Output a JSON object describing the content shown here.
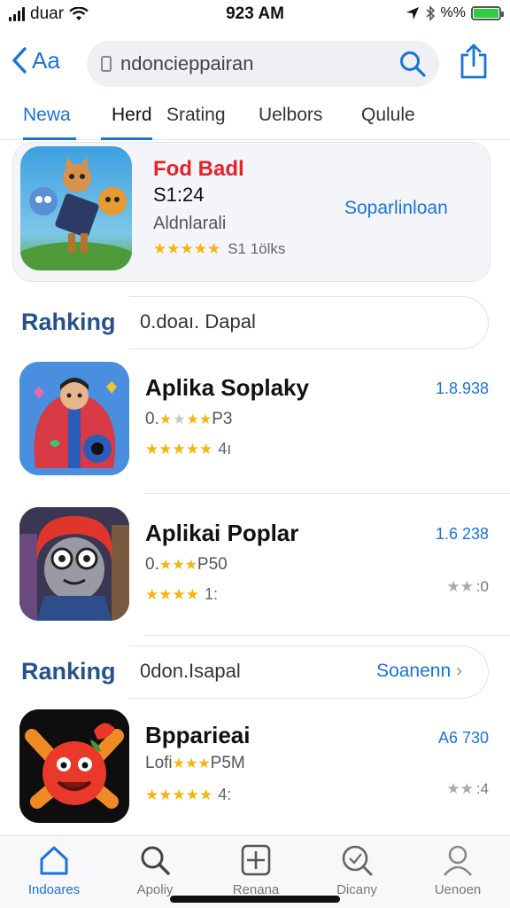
{
  "status_bar": {
    "carrier": "duar",
    "time": "923 AM",
    "battery_text": "%%"
  },
  "nav": {
    "back_label": "Aa",
    "search_value": "ndoncieppairan",
    "search_placeholder": ""
  },
  "tabs": [
    {
      "label": "Newa",
      "active": true
    },
    {
      "label": "Herd",
      "active": false
    },
    {
      "label": "Srating",
      "active": false
    },
    {
      "label": "Uelbors",
      "active": false
    },
    {
      "label": "Qulule",
      "active": false
    }
  ],
  "featured": {
    "title": "Fod Badl",
    "price": "S1:24",
    "developer": "Aldnlarali",
    "rating_text": "S1 1ölks",
    "stars": 5,
    "cta": "Soparlinloan",
    "icon": "cartoon-creatures-icon"
  },
  "sections": [
    {
      "label": "Rahking",
      "text": "0.doaı. Dapal",
      "action": ""
    },
    {
      "label": "Ranking",
      "text": "0don.Isapal",
      "action": "Soanenn"
    }
  ],
  "apps": [
    {
      "name": "Aplika Soplaky",
      "subtitle": "0.",
      "subtitle_tail": "P3",
      "rating_text": "4ı",
      "count": "1.8.938",
      "meta": "",
      "stars": 4.5,
      "icon": "cartoon-boy-icon"
    },
    {
      "name": "Aplikai Poplar",
      "subtitle": "0.",
      "subtitle_tail": "P50",
      "rating_text": "1:",
      "count": "1.6 238",
      "meta": ":0",
      "stars": 4,
      "icon": "red-haired-character-icon"
    },
    {
      "name": "Bpparieai",
      "subtitle": "Lofi",
      "subtitle_tail": "P5M",
      "rating_text": "4:",
      "count": "A6 730",
      "meta": ":4",
      "stars": 4.5,
      "icon": "red-monster-icon"
    }
  ],
  "tab_bar": [
    {
      "label": "Indoares",
      "icon": "home-icon",
      "active": true
    },
    {
      "label": "Apoliy",
      "icon": "search-icon",
      "active": false
    },
    {
      "label": "Renana",
      "icon": "add-icon",
      "active": false
    },
    {
      "label": "Dicany",
      "icon": "discover-icon",
      "active": false
    },
    {
      "label": "Uenoen",
      "icon": "profile-icon",
      "active": false
    }
  ],
  "colors": {
    "accent": "#1a73d9",
    "section_label": "#25528c",
    "featured_title": "#e8202a",
    "star": "#f5b50e"
  }
}
